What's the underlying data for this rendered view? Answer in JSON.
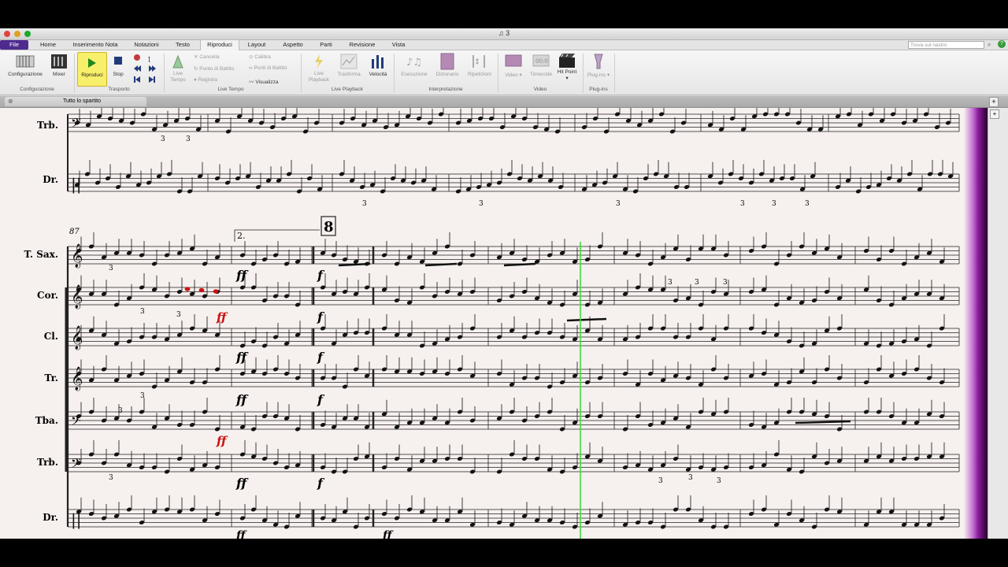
{
  "window": {
    "title": "3"
  },
  "tabs": [
    {
      "label": "File"
    },
    {
      "label": "Home"
    },
    {
      "label": "Inserimento Nota"
    },
    {
      "label": "Notazioni"
    },
    {
      "label": "Testo"
    },
    {
      "label": "Riproduci"
    },
    {
      "label": "Layout"
    },
    {
      "label": "Aspetto"
    },
    {
      "label": "Parti"
    },
    {
      "label": "Revisione"
    },
    {
      "label": "Vista"
    }
  ],
  "search": {
    "placeholder": "Trova sul nastro"
  },
  "ribbon": {
    "configurazione": {
      "label": "Configurazione",
      "mixer": "Mixer",
      "group": "Configurazione"
    },
    "trasporto": {
      "riproduci": "Riproduci",
      "stop": "Stop",
      "group": "Trasporto"
    },
    "live_tempo": {
      "live_tempo": "Live Tempo",
      "cancella": "Cancella",
      "punto_battito": "Punto di Battito",
      "registra": "Registra",
      "calibra": "Calibra",
      "punti_battito": "Punti di Battito",
      "visualizza": "Visualizza",
      "group": "Live Tempo"
    },
    "live_playback": {
      "live_playback": "Live Playback",
      "trasforma": "Trasforma",
      "velocita": "Velocità",
      "group": "Live Playback"
    },
    "interpretazione": {
      "esecuzione": "Esecuzione",
      "dizionario": "Dizionario",
      "ripetizioni": "Ripetizioni",
      "group": "Interpretazione"
    },
    "video": {
      "video": "Video",
      "timecode": "Timecode",
      "hit_point": "Hit Point",
      "group": "Video"
    },
    "plugins": {
      "plugins": "Plug-ins",
      "group": "Plug-ins"
    }
  },
  "score_tab": {
    "label": "Tutto lo spartito"
  },
  "score": {
    "top_system": {
      "instruments": [
        "Trb.",
        "Dr."
      ]
    },
    "bottom_system": {
      "bar_number": "87",
      "ending": "2.",
      "rehearsal": "8",
      "instruments": [
        "T. Sax.",
        "Cor.",
        "Cl.",
        "Tr.",
        "Tba.",
        "Trb.",
        "Dr."
      ],
      "dynamics": {
        "ff": "ff",
        "f": "f"
      },
      "triplet": "3"
    }
  },
  "colors": {
    "file_tab": "#4e2a8e",
    "playback_line": "#3fdc3f",
    "paper": "#f6f0ee",
    "accent_red": "#cc1111"
  }
}
